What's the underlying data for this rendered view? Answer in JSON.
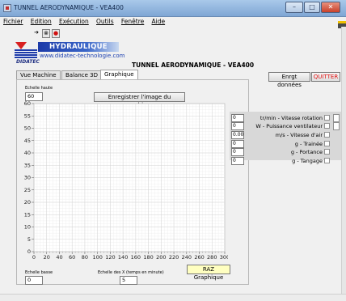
{
  "window": {
    "title": "TUNNEL AERODYNAMIQUE - VEA400",
    "min_glyph": "–",
    "max_glyph": "□",
    "close_glyph": "✕"
  },
  "menu": [
    "Fichier",
    "Edition",
    "Exécution",
    "Outils",
    "Fenêtre",
    "Aide"
  ],
  "toolbar": {
    "run_glyph": "➔",
    "stop_glyph": "⊗",
    "pause_glyph": "●"
  },
  "logo": {
    "brand": "DIDATEC",
    "banner": "HYDRAULIQUE",
    "url": "www.didatec-technologie.com"
  },
  "app_title": "TUNNEL AERODYNAMIQUE - VEA400",
  "tabs": [
    {
      "label": "Vue Machine"
    },
    {
      "label": "Balance 3D"
    },
    {
      "label": "Graphique",
      "active": true
    }
  ],
  "buttons": {
    "save_data": "Enrgt données",
    "quit": "QUITTER",
    "save_image": "Enregistrer l'image du graphique",
    "reset": "RAZ Graphique"
  },
  "controls": {
    "scale_high_label": "Echelle haute",
    "scale_high_value": "60",
    "scale_low_label": "Echelle basse",
    "scale_low_value": "0",
    "x_scale_label": "Echelle des X (temps en minute)",
    "x_scale_value": "5"
  },
  "readouts": [
    {
      "value": "0",
      "label": "tr/min - Vitesse rotation"
    },
    {
      "value": "0",
      "label": "W - Puissance ventilateur"
    },
    {
      "value": "0.00",
      "label": "m/s - Vitesse d'air"
    },
    {
      "value": "0",
      "label": "g - Trainée"
    },
    {
      "value": "0",
      "label": "g - Portance"
    },
    {
      "value": "0",
      "label": "g - Tangage"
    }
  ],
  "chart_data": {
    "type": "line",
    "x_ticks": [
      0,
      20,
      40,
      60,
      80,
      100,
      120,
      140,
      160,
      180,
      200,
      220,
      240,
      260,
      280,
      300
    ],
    "y_ticks": [
      0,
      5,
      10,
      15,
      20,
      25,
      30,
      35,
      40,
      45,
      50,
      55,
      60
    ],
    "xlim": [
      0,
      300
    ],
    "ylim": [
      0,
      60
    ],
    "grid": true,
    "series": []
  },
  "colors": {
    "plot_bg": "#ffffff",
    "grid": "#d4d4d4",
    "quit_text": "#e01010",
    "reset_bg": "#ffffc0"
  }
}
